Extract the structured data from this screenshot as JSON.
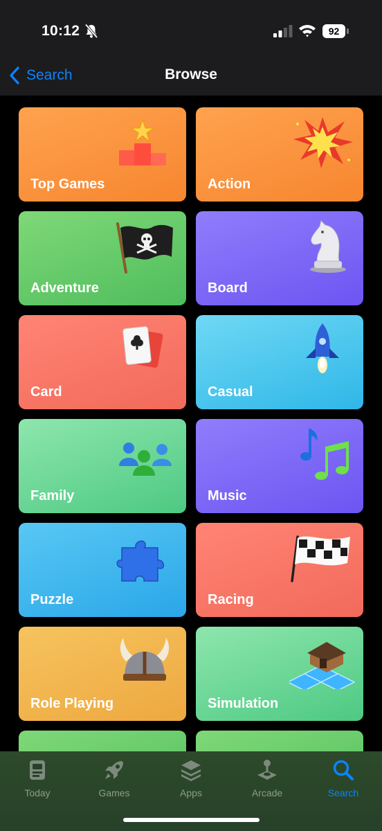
{
  "status": {
    "time": "10:12",
    "battery": "92"
  },
  "nav": {
    "back_label": "Search",
    "title": "Browse"
  },
  "categories": [
    {
      "label": "Top Games",
      "icon": "podium-star-icon",
      "color": "#f7862f"
    },
    {
      "label": "Action",
      "icon": "explosion-icon",
      "color": "#f7862f"
    },
    {
      "label": "Adventure",
      "icon": "pirate-flag-icon",
      "color": "#4fbd5d"
    },
    {
      "label": "Board",
      "icon": "chess-knight-icon",
      "color": "#6c55f2"
    },
    {
      "label": "Card",
      "icon": "playing-cards-icon",
      "color": "#f26a5b"
    },
    {
      "label": "Casual",
      "icon": "rocket-icon",
      "color": "#2fb7e8"
    },
    {
      "label": "Family",
      "icon": "game-pieces-icon",
      "color": "#4dc982"
    },
    {
      "label": "Music",
      "icon": "music-notes-icon",
      "color": "#6c55f2"
    },
    {
      "label": "Puzzle",
      "icon": "puzzle-piece-icon",
      "color": "#2aa6e8"
    },
    {
      "label": "Racing",
      "icon": "checkered-flag-icon",
      "color": "#f26a5b"
    },
    {
      "label": "Role Playing",
      "icon": "viking-helmet-icon",
      "color": "#eea840"
    },
    {
      "label": "Simulation",
      "icon": "house-tiles-icon",
      "color": "#4dc982"
    }
  ],
  "tabs": [
    {
      "label": "Today",
      "icon": "today-icon"
    },
    {
      "label": "Games",
      "icon": "rocket-tab-icon"
    },
    {
      "label": "Apps",
      "icon": "layers-icon"
    },
    {
      "label": "Arcade",
      "icon": "joystick-icon"
    },
    {
      "label": "Search",
      "icon": "search-icon",
      "active": true
    }
  ],
  "accent": "#0a84ff"
}
